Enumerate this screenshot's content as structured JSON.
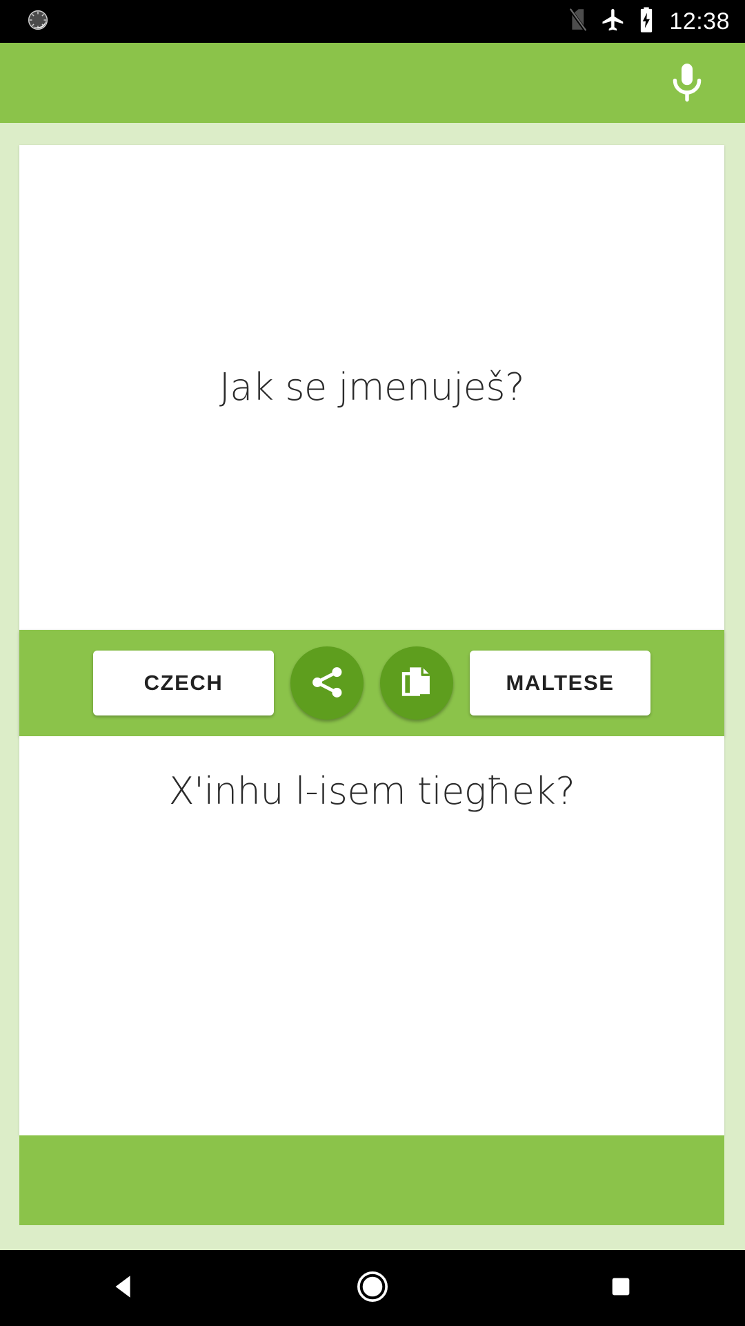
{
  "status_bar": {
    "time": "12:38",
    "left_icons": [
      {
        "name": "alarm-snooze-icon"
      }
    ],
    "right_icons": [
      {
        "name": "no-sim-card-icon"
      },
      {
        "name": "airplane-mode-icon"
      },
      {
        "name": "battery-charging-icon"
      }
    ]
  },
  "app_bar": {
    "mic_label": "microphone"
  },
  "source": {
    "text": "Jak se jmenuješ?",
    "language_label": "CZECH"
  },
  "target": {
    "text": "X'inhu l-isem tiegħek?",
    "language_label": "MALTESE"
  },
  "actions": {
    "share_label": "share",
    "copy_label": "copy"
  },
  "nav_bar": {
    "back_label": "back",
    "home_label": "home",
    "recents_label": "recents"
  },
  "colors": {
    "accent_green": "#8bc34a",
    "dark_green": "#5e9e1e",
    "background_green": "#dcedc8",
    "card_white": "#ffffff",
    "text_dark": "#2b2b2b"
  }
}
